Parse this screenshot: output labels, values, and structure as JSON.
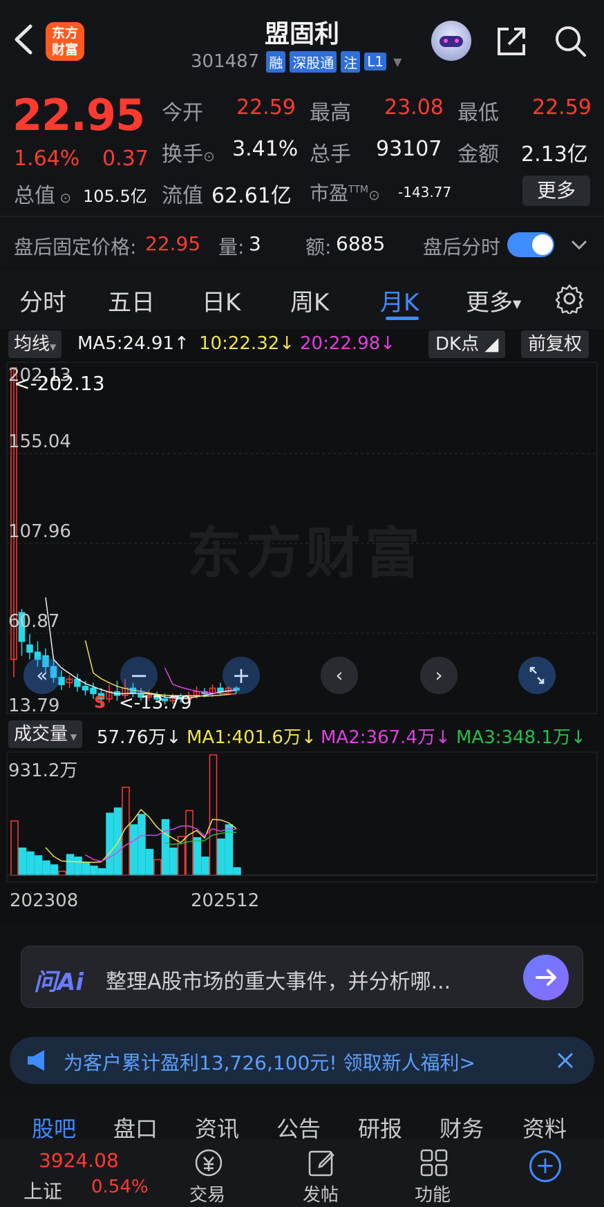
{
  "header": {
    "title": "盟固利",
    "code": "301487",
    "badges": [
      "融",
      "深股通",
      "注",
      "L1"
    ],
    "logo_text": "东方财富"
  },
  "quote": {
    "price": "22.95",
    "change_pct": "1.64%",
    "change": "0.37",
    "open_label": "今开",
    "open": "22.59",
    "high_label": "最高",
    "high": "23.08",
    "low_label": "最低",
    "low": "22.59",
    "turnover_label": "换手",
    "turnover": "3.41%",
    "volume_label": "总手",
    "volume": "93107",
    "amount_label": "金额",
    "amount": "2.13亿",
    "mktcap_label": "总值",
    "mktcap": "105.5亿",
    "float_label": "流值",
    "float": "62.61亿",
    "pe_label": "市盈",
    "pe_sup": "TTM",
    "pe": "-143.77",
    "more_btn": "更多",
    "after_label": "盘后固定价格:",
    "after_price": "22.95",
    "after_vol_label": "量:",
    "after_vol": "3",
    "after_amt_label": "额:",
    "after_amt": "6885",
    "after_toggle_label": "盘后分时"
  },
  "tabs": [
    "分时",
    "五日",
    "日K",
    "周K",
    "月K",
    "更多"
  ],
  "active_tab": "月K",
  "chart_header": {
    "ma_btn": "均线",
    "ma5": "MA5:24.91",
    "ma10": "10:22.32",
    "ma20": "20:22.98",
    "dk_btn": "DK点",
    "adj_btn": "前复权"
  },
  "price_axis": [
    "202.13",
    "155.04",
    "107.96",
    "60.87",
    "13.79"
  ],
  "price_marker_high": "<-202.13",
  "price_marker_low": "<-13.79",
  "s_mark": "S",
  "watermark": "东方财富",
  "volume_header": {
    "label": "成交量",
    "current": "57.76万",
    "ma1": "MA1:401.6万",
    "ma2": "MA2:367.4万",
    "ma3": "MA3:348.1万"
  },
  "volume_axis_max": "931.2万",
  "date_start": "202308",
  "date_end": "202512",
  "ai_bar": {
    "logo": "问Ai",
    "prompt": "整理A股市场的重大事件，并分析哪..."
  },
  "promo": {
    "text": "为客户累计盈利13,726,100元! 领取新人福利>"
  },
  "sub_tabs": [
    "股吧",
    "盘口",
    "资讯",
    "公告",
    "研报",
    "财务",
    "资料"
  ],
  "index": {
    "value": "3924.08",
    "name": "上证",
    "pct": "0.54%"
  },
  "bottom_nav": [
    "交易",
    "发帖",
    "功能"
  ],
  "colors": {
    "up": "#ff3b30",
    "down": "#26d9e6",
    "accent": "#3e8cff",
    "ma5": "#f0f0f0",
    "ma10": "#f2e34a",
    "ma20": "#e040e0",
    "ma3": "#26c04a"
  },
  "chart_data": {
    "type": "candlestick",
    "x_range": [
      "202308",
      "202512"
    ],
    "price_ylim": [
      13.79,
      202.13
    ],
    "volume_ylim": [
      0,
      931.2
    ],
    "volume_unit": "万",
    "ma": {
      "MA5": 24.91,
      "MA10": 22.32,
      "MA20": 22.98
    },
    "volume_ma": {
      "MA1": 401.6,
      "MA2": 367.4,
      "MA3": 348.1
    },
    "candles": [
      {
        "o": 40,
        "c": 202.13,
        "h": 202.13,
        "l": 30,
        "up": true
      },
      {
        "o": 66,
        "c": 50,
        "h": 68,
        "l": 42,
        "up": false
      },
      {
        "o": 48,
        "c": 44,
        "h": 54,
        "l": 40,
        "up": false
      },
      {
        "o": 44,
        "c": 40,
        "h": 50,
        "l": 36,
        "up": false
      },
      {
        "o": 42,
        "c": 36,
        "h": 46,
        "l": 33,
        "up": false
      },
      {
        "o": 36,
        "c": 30,
        "h": 41,
        "l": 27,
        "up": false
      },
      {
        "o": 30,
        "c": 26,
        "h": 34,
        "l": 23,
        "up": false
      },
      {
        "o": 27,
        "c": 29,
        "h": 31,
        "l": 24,
        "up": true
      },
      {
        "o": 29,
        "c": 25,
        "h": 32,
        "l": 22,
        "up": false
      },
      {
        "o": 25,
        "c": 23,
        "h": 28,
        "l": 20,
        "up": false
      },
      {
        "o": 24,
        "c": 21,
        "h": 27,
        "l": 18,
        "up": false
      },
      {
        "o": 21,
        "c": 18,
        "h": 24,
        "l": 13.79,
        "up": false
      },
      {
        "o": 18,
        "c": 22,
        "h": 26,
        "l": 16,
        "up": true
      },
      {
        "o": 22,
        "c": 20,
        "h": 28,
        "l": 17,
        "up": false
      },
      {
        "o": 20,
        "c": 24,
        "h": 29,
        "l": 18,
        "up": true
      },
      {
        "o": 24,
        "c": 21,
        "h": 27,
        "l": 19,
        "up": false
      },
      {
        "o": 21,
        "c": 19,
        "h": 24,
        "l": 17,
        "up": false
      },
      {
        "o": 19,
        "c": 20,
        "h": 23,
        "l": 17,
        "up": true
      },
      {
        "o": 20,
        "c": 18,
        "h": 22,
        "l": 16,
        "up": false
      },
      {
        "o": 18,
        "c": 17,
        "h": 21,
        "l": 15,
        "up": false
      },
      {
        "o": 17,
        "c": 19,
        "h": 21,
        "l": 15,
        "up": true
      },
      {
        "o": 19,
        "c": 18,
        "h": 21,
        "l": 16,
        "up": false
      },
      {
        "o": 18,
        "c": 20,
        "h": 22,
        "l": 16,
        "up": true
      },
      {
        "o": 20,
        "c": 22,
        "h": 25,
        "l": 18,
        "up": true
      },
      {
        "o": 22,
        "c": 21,
        "h": 24,
        "l": 19,
        "up": false
      },
      {
        "o": 21,
        "c": 24,
        "h": 26,
        "l": 19,
        "up": true
      },
      {
        "o": 24,
        "c": 22,
        "h": 27,
        "l": 20,
        "up": false
      },
      {
        "o": 22,
        "c": 24,
        "h": 25,
        "l": 20,
        "up": true
      },
      {
        "o": 24,
        "c": 22.95,
        "h": 25,
        "l": 21,
        "up": false
      }
    ],
    "volumes": [
      {
        "v": 420,
        "up": true
      },
      {
        "v": 210,
        "up": false
      },
      {
        "v": 180,
        "up": false
      },
      {
        "v": 150,
        "up": false
      },
      {
        "v": 110,
        "up": false
      },
      {
        "v": 80,
        "up": false
      },
      {
        "v": 30,
        "up": true
      },
      {
        "v": 160,
        "up": false
      },
      {
        "v": 140,
        "up": false
      },
      {
        "v": 95,
        "up": false
      },
      {
        "v": 70,
        "up": false
      },
      {
        "v": 50,
        "up": false
      },
      {
        "v": 480,
        "up": false
      },
      {
        "v": 520,
        "up": false
      },
      {
        "v": 680,
        "up": true
      },
      {
        "v": 390,
        "up": false
      },
      {
        "v": 470,
        "up": false
      },
      {
        "v": 200,
        "up": false
      },
      {
        "v": 120,
        "up": true
      },
      {
        "v": 430,
        "up": false
      },
      {
        "v": 210,
        "up": false
      },
      {
        "v": 300,
        "up": true
      },
      {
        "v": 500,
        "up": true
      },
      {
        "v": 290,
        "up": false
      },
      {
        "v": 140,
        "up": false
      },
      {
        "v": 931.2,
        "up": true
      },
      {
        "v": 280,
        "up": false
      },
      {
        "v": 390,
        "up": false
      },
      {
        "v": 57.76,
        "up": false
      }
    ]
  }
}
